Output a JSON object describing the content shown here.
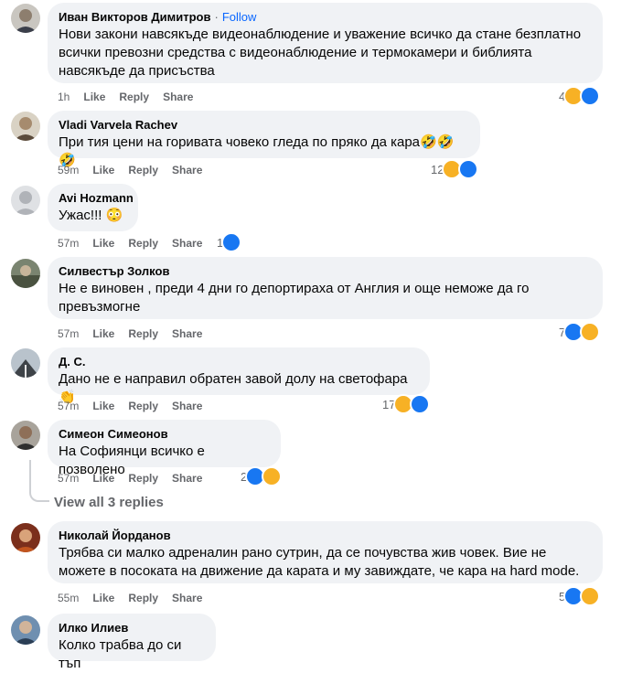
{
  "comments": [
    {
      "author": "Иван Викторов Димитров",
      "follow": "Follow",
      "text": "Нови закони навсякъде видеонаблюдение и уважение всичко да стане безплатно всички превозни средства с видеонаблюдение и термокамери и библията навсякъде да присъства",
      "time": "1h",
      "like": "Like",
      "reply": "Reply",
      "share": "Share",
      "reaction_count": "4",
      "reactions": [
        "haha-icon",
        "like-icon"
      ]
    },
    {
      "author": "Vladi Varvela Rachev",
      "text": "При тия цени на горивата човеко гледа по пряко да кара",
      "emoji_suffix": "🤣🤣🤣",
      "time": "59m",
      "like": "Like",
      "reply": "Reply",
      "share": "Share",
      "reaction_count": "12",
      "reactions": [
        "haha-icon",
        "like-icon"
      ]
    },
    {
      "author": "Avi Hozmann",
      "text": "Ужас!!!",
      "emoji_suffix": "😳",
      "time": "57m",
      "like": "Like",
      "reply": "Reply",
      "share": "Share",
      "reaction_count": "1",
      "reactions": [
        "like-icon"
      ]
    },
    {
      "author": "Силвестър Золков",
      "text": "Не е виновен , преди 4 дни го депортираха от Англия и още неможе да го превъзмогне",
      "time": "57m",
      "like": "Like",
      "reply": "Reply",
      "share": "Share",
      "reaction_count": "7",
      "reactions": [
        "like-icon",
        "haha-icon"
      ]
    },
    {
      "author": "Д. С.",
      "text": "Дано не е направил обратен завой долу на светофара",
      "emoji_suffix": "👏",
      "time": "57m",
      "like": "Like",
      "reply": "Reply",
      "share": "Share",
      "reaction_count": "17",
      "reactions": [
        "haha-icon",
        "like-icon"
      ]
    },
    {
      "author": "Симеон Симеонов",
      "text": "На Софиянци всичко е позволено",
      "time": "57m",
      "like": "Like",
      "reply": "Reply",
      "share": "Share",
      "reaction_count": "2",
      "reactions": [
        "like-icon",
        "haha-icon"
      ]
    },
    {
      "author": "Николай Йорданов",
      "text": "Трябва си малко адреналин рано сутрин, да се почувства жив човек. Вие не можете в посоката на движение да карата и му завиждате, че кара на hard mode.",
      "time": "55m",
      "like": "Like",
      "reply": "Reply",
      "share": "Share",
      "reaction_count": "5",
      "reactions": [
        "like-icon",
        "haha-icon"
      ]
    },
    {
      "author": "Илко Илиев",
      "text": "Колко трабва до си тъп"
    }
  ],
  "view_all_replies": "View all 3 replies",
  "colors": {
    "like": "#1877f2",
    "haha": "#f7b125",
    "bubble": "#f0f2f5",
    "meta": "#65676b",
    "link": "#0866ff"
  }
}
